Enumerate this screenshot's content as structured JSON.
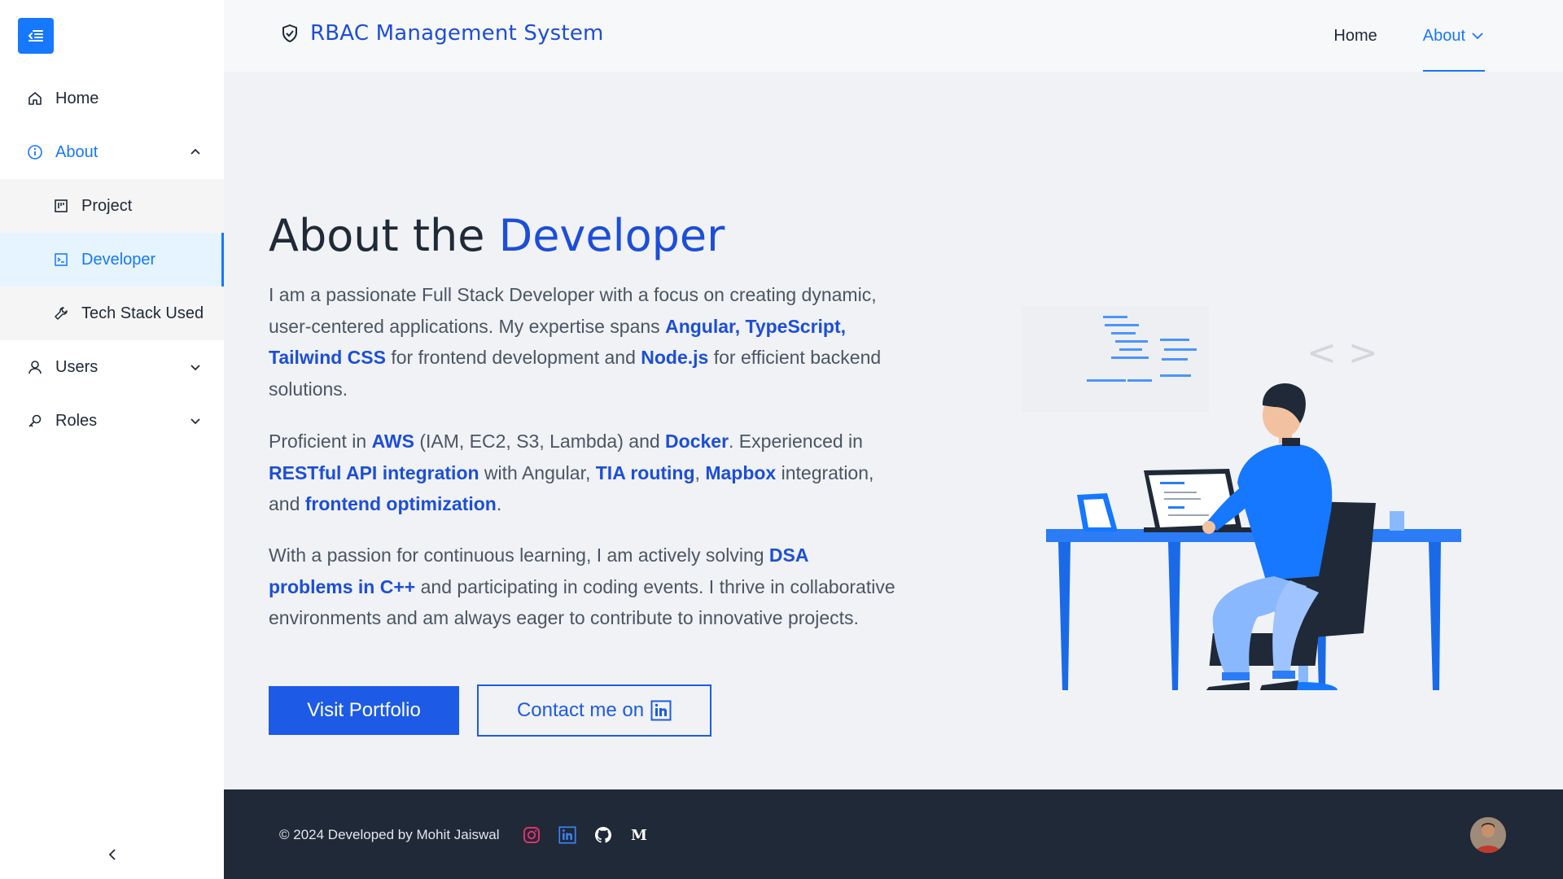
{
  "header": {
    "title": "RBAC Management System",
    "nav": [
      {
        "label": "Home"
      },
      {
        "label": "About"
      }
    ]
  },
  "sidebar": {
    "items": [
      {
        "label": "Home",
        "icon": "home-icon"
      },
      {
        "label": "About",
        "icon": "info-icon",
        "expanded": true,
        "children": [
          {
            "label": "Project",
            "icon": "project-icon"
          },
          {
            "label": "Developer",
            "icon": "terminal-icon",
            "selected": true
          },
          {
            "label": "Tech Stack Used",
            "icon": "wrench-icon"
          }
        ]
      },
      {
        "label": "Users",
        "icon": "user-icon"
      },
      {
        "label": "Roles",
        "icon": "key-icon"
      }
    ]
  },
  "main": {
    "heading_prefix": "About the ",
    "heading_accent": "Developer",
    "p1": {
      "t1": "I am a passionate Full Stack Developer with a focus on creating dynamic, user-centered applications. My expertise spans ",
      "b1": "Angular, TypeScript, Tailwind CSS",
      "t2": " for frontend development and ",
      "b2": "Node.js",
      "t3": " for efficient backend solutions."
    },
    "p2": {
      "t1": "Proficient in ",
      "b1": "AWS",
      "t2": " (IAM, EC2, S3, Lambda) and ",
      "b2": "Docker",
      "t3": ". Experienced in ",
      "b3": "RESTful API integration",
      "t4": " with Angular, ",
      "b4": "TIA routing",
      "t5": ", ",
      "b5": "Mapbox",
      "t6": " integration, and ",
      "b6": "frontend optimization",
      "t7": "."
    },
    "p3": {
      "t1": "With a passion for continuous learning, I am actively solving ",
      "b1": "DSA problems in C++",
      "t2": " and participating in coding events. I thrive in collaborative environments and am always eager to contribute to innovative projects."
    },
    "btn_portfolio": "Visit Portfolio",
    "btn_contact": "Contact me on"
  },
  "footer": {
    "copyright": "© 2024 Developed by Mohit Jaiswal",
    "socials": [
      "instagram-icon",
      "linkedin-icon",
      "github-icon",
      "medium-icon"
    ]
  },
  "colors": {
    "accent": "#1677ff",
    "brand_text": "#1d4ed8",
    "footer_bg": "#1f2937"
  }
}
